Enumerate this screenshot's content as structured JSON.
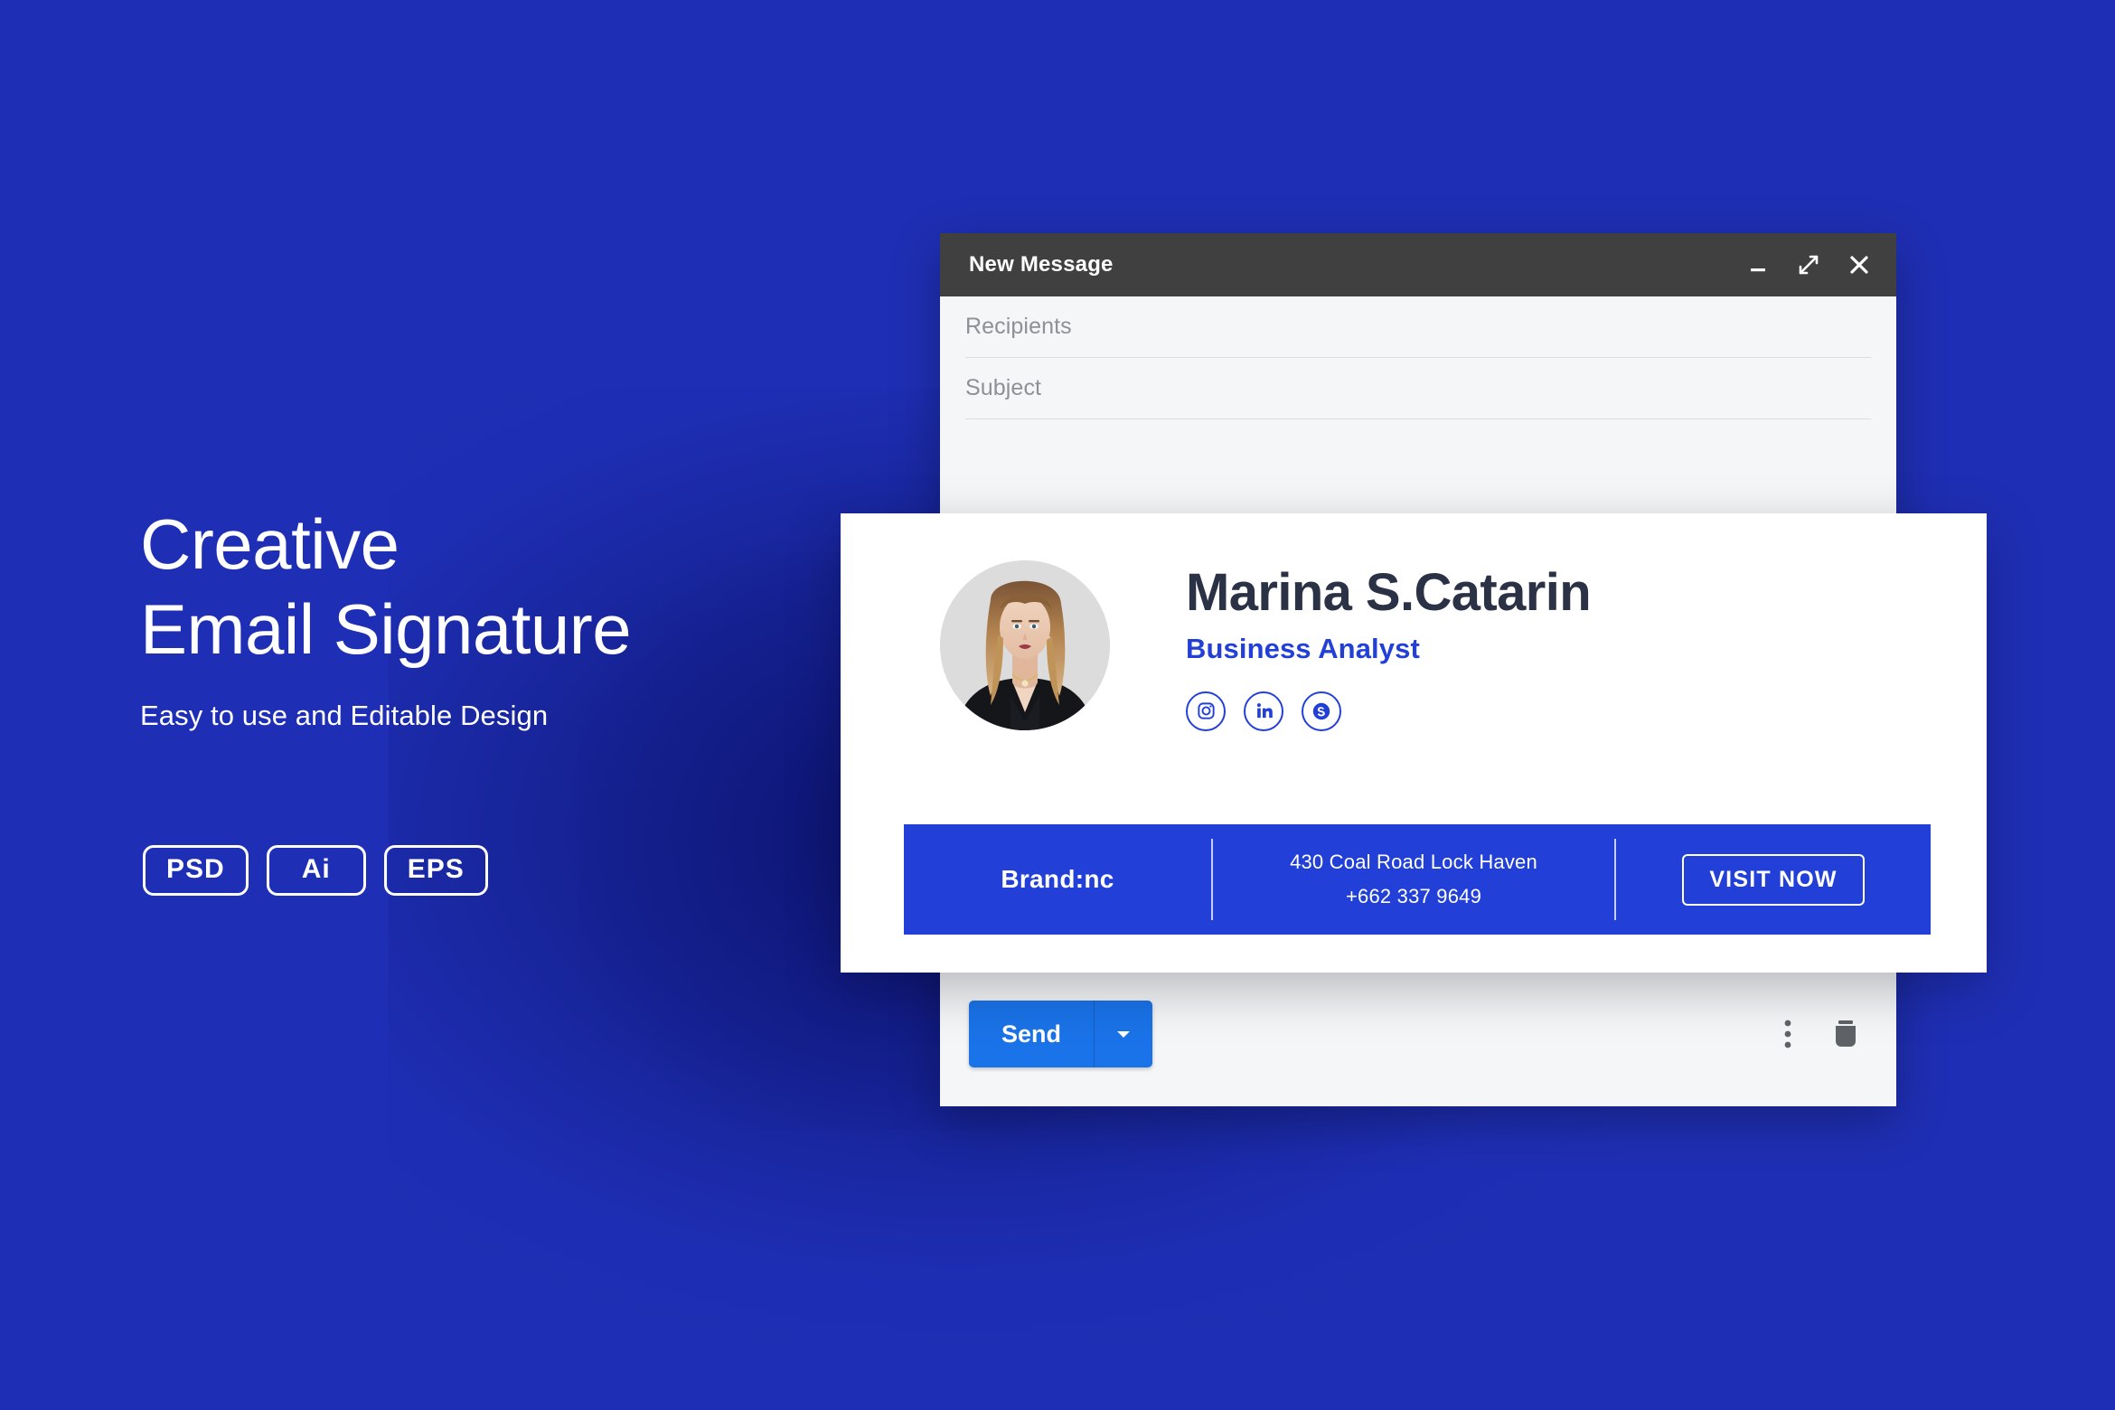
{
  "theme": {
    "background_blue": "#1f2fb5",
    "brand_blue": "#2240d8",
    "send_blue": "#1a73e8",
    "header_gray": "#404040",
    "name_navy": "#2b3245"
  },
  "promo": {
    "title": "Creative\nEmail Signature",
    "subtitle": "Easy to use and Editable Design",
    "badges": [
      {
        "label": "PSD"
      },
      {
        "label": "Ai"
      },
      {
        "label": "EPS"
      }
    ]
  },
  "compose": {
    "title": "New Message",
    "window_controls": [
      {
        "name": "minimize",
        "glyph": "minimize-icon"
      },
      {
        "name": "expand",
        "glyph": "expand-icon"
      },
      {
        "name": "close",
        "glyph": "close-icon"
      }
    ],
    "fields": [
      {
        "name": "recipients",
        "placeholder": "Recipients",
        "value": ""
      },
      {
        "name": "subject",
        "placeholder": "Subject",
        "value": ""
      }
    ],
    "footer": {
      "send_label": "Send",
      "send_dropdown_icon": "chevron-down-icon",
      "more_options_icon": "more-vertical-icon",
      "delete_icon": "trash-icon"
    }
  },
  "signature": {
    "avatar_alt": "portrait-photo",
    "name": "Marina S.Catarin",
    "role": "Business Analyst",
    "socials": [
      {
        "name": "instagram",
        "icon": "instagram-icon"
      },
      {
        "name": "linkedin",
        "icon": "linkedin-icon"
      },
      {
        "name": "skype",
        "icon": "skype-icon"
      }
    ],
    "contact_bar": {
      "brand": "Brand:nc",
      "address": "430 Coal Road Lock Haven",
      "phone": "+662 337 9649",
      "cta_label": "VISIT NOW"
    }
  }
}
